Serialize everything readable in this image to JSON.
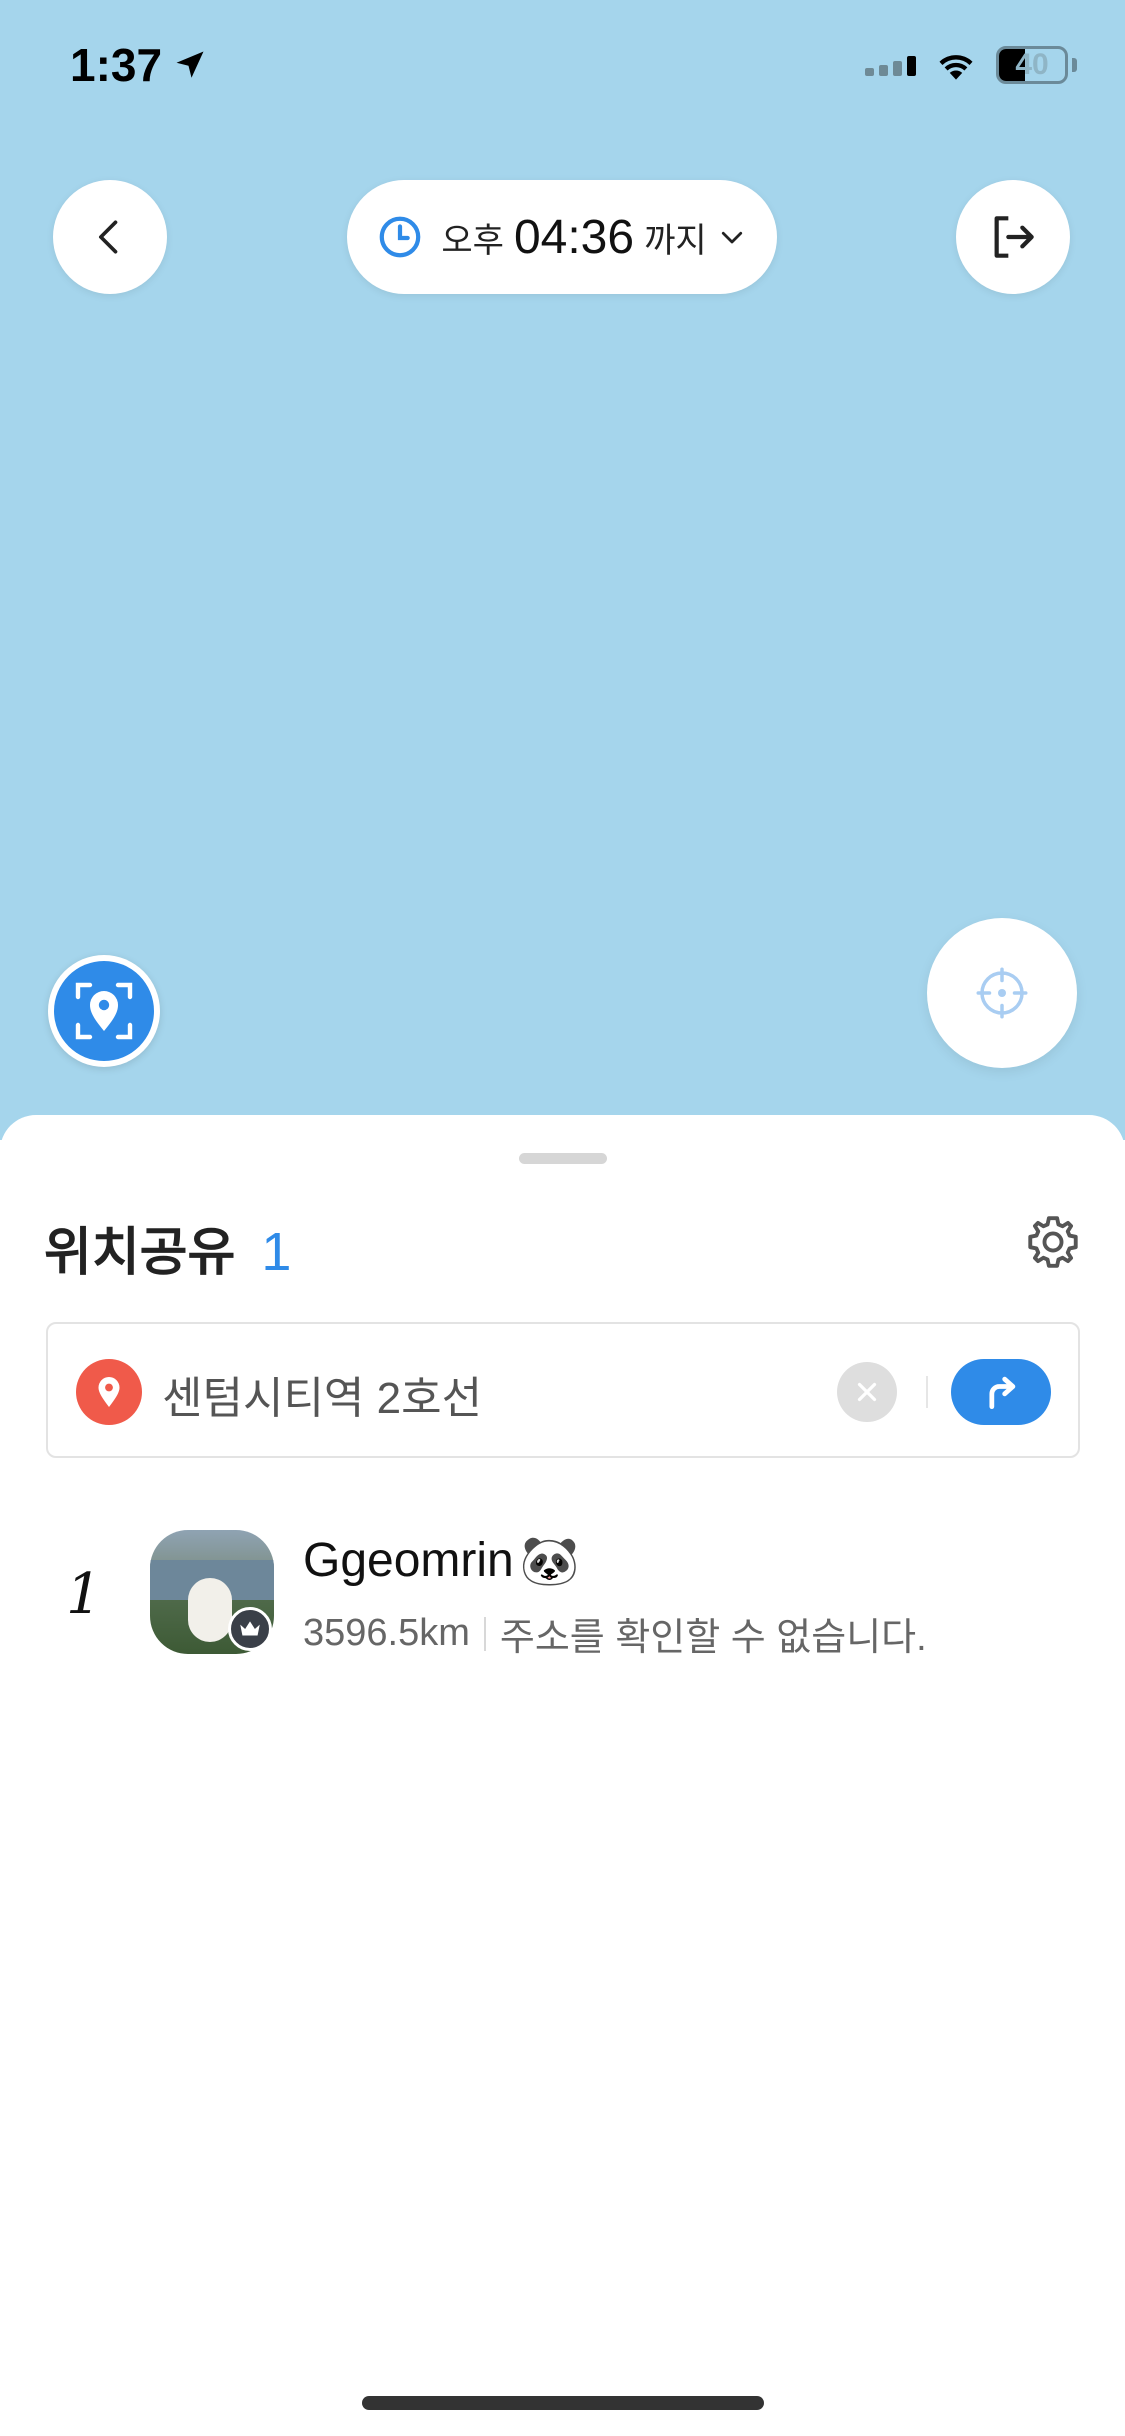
{
  "status_bar": {
    "time": "1:37",
    "battery": "40",
    "battery_level": 0.4
  },
  "map_header": {
    "time_pill": {
      "ampm": "오후",
      "time": "04:36",
      "until": "까지"
    }
  },
  "sheet": {
    "title": "위치공유",
    "count": "1",
    "place": {
      "name": "센텀시티역 2호선"
    },
    "members": [
      {
        "rank": "1",
        "name": "Ggeomrin",
        "emoji": "🐼",
        "distance": "3596.5km",
        "address": "주소를 확인할 수 없습니다."
      }
    ]
  },
  "colors": {
    "map": "#a5d5ec",
    "accent": "#2f8be8",
    "pin": "#f05a4a"
  },
  "icons": [
    "back-icon",
    "clock-icon",
    "chevron-down-icon",
    "exit-icon",
    "scan-location-icon",
    "crosshair-icon",
    "gear-icon",
    "map-pin-icon",
    "close-icon",
    "route-arrow-icon",
    "crown-icon",
    "location-arrow-icon",
    "wifi-icon",
    "signal-icon",
    "battery-icon"
  ]
}
